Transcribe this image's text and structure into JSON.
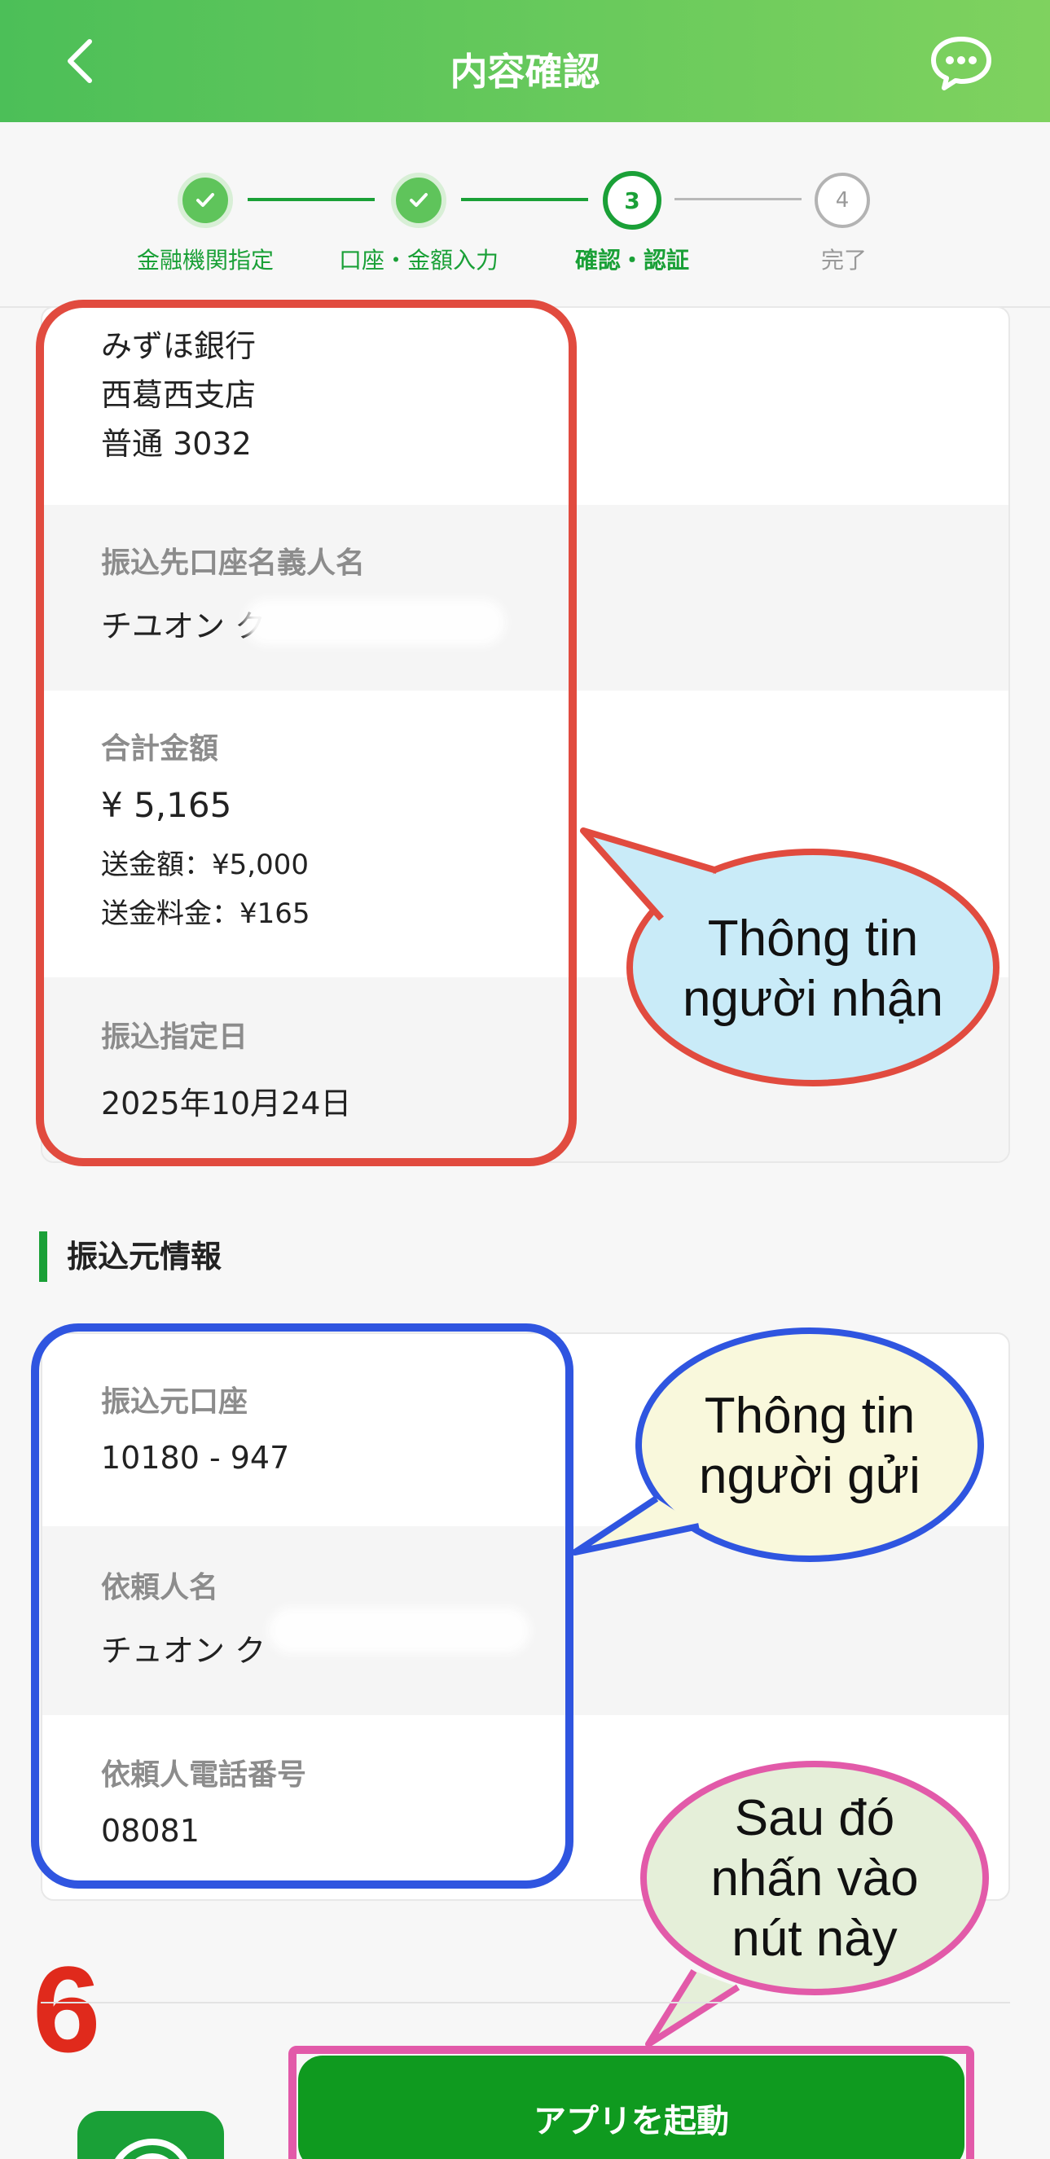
{
  "header": {
    "title": "内容確認",
    "back_icon": "chevron-left-icon",
    "chat_icon": "chat-bubble-icon",
    "gradient": [
      "#4cbf58",
      "#7fd25f"
    ]
  },
  "stepper": {
    "steps": [
      {
        "number": "1",
        "label": "金融機関指定",
        "state": "done"
      },
      {
        "number": "2",
        "label": "口座・金額入力",
        "state": "done"
      },
      {
        "number": "3",
        "label": "確認・認証",
        "state": "current"
      },
      {
        "number": "4",
        "label": "完了",
        "state": "todo"
      }
    ]
  },
  "recipient": {
    "bank_name": "みずほ銀行",
    "branch": "西葛西支店",
    "account": "普通 3032",
    "holder_label": "振込先口座名義人名",
    "holder_value": "チユオン ク",
    "total_label": "合計金額",
    "total_value": "¥ 5,165",
    "amount_line": "送金額：¥5,000",
    "fee_line": "送金料金：¥165",
    "date_label": "振込指定日",
    "date_value": "2025年10月24日"
  },
  "sender_section": {
    "title": "振込元情報",
    "account_label": "振込元口座",
    "account_value": "10180 - 947",
    "name_label": "依頼人名",
    "name_value": "チュオン ク",
    "phone_label": "依頼人電話番号",
    "phone_value": "08081"
  },
  "annotations": {
    "recipient_bubble": [
      "Thông tin",
      "người nhận"
    ],
    "sender_bubble": [
      "Thông tin",
      "người gửi"
    ],
    "button_bubble": [
      "Sau đó",
      "nhấn vào",
      "nút này"
    ],
    "step_number": "6"
  },
  "footer": {
    "launch_button": "アプリを起動"
  },
  "colors": {
    "accent": "#1aa037",
    "red": "#e14b3f",
    "blue": "#2f55e0",
    "pink": "#e25aa9"
  }
}
